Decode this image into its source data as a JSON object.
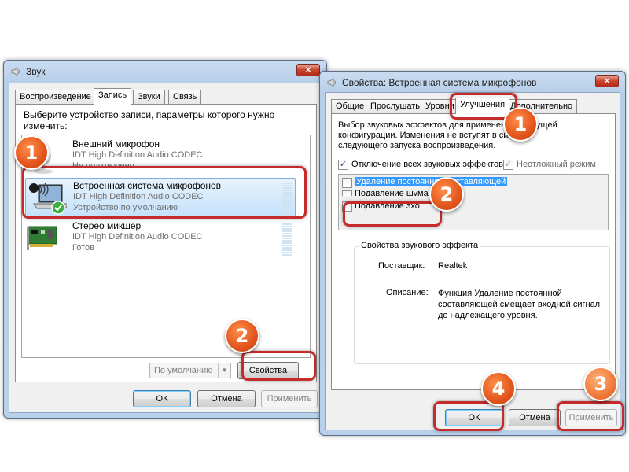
{
  "left_window": {
    "title": "Звук",
    "close_label": "✕",
    "tabs": [
      {
        "label": "Воспроизведение"
      },
      {
        "label": "Запись"
      },
      {
        "label": "Звуки"
      },
      {
        "label": "Связь"
      }
    ],
    "instruction": "Выберите устройство записи, параметры которого нужно изменить:",
    "devices": [
      {
        "name": "Внешний микрофон",
        "driver": "IDT High Definition Audio CODEC",
        "status": "Не подключено"
      },
      {
        "name": "Встроенная система микрофонов",
        "driver": "IDT High Definition Audio CODEC",
        "status": "Устройство по умолчанию"
      },
      {
        "name": "Стерео микшер",
        "driver": "IDT High Definition Audio CODEC",
        "status": "Готов"
      }
    ],
    "default_select": "По умолчанию",
    "properties_button": "Свойства",
    "ok": "ОК",
    "cancel": "Отмена",
    "apply": "Применить"
  },
  "right_window": {
    "title": "Свойства: Встроенная система микрофонов",
    "close_label": "✕",
    "tabs": [
      {
        "label": "Общие"
      },
      {
        "label": "Прослушать"
      },
      {
        "label": "Уровни"
      },
      {
        "label": "Улучшения"
      },
      {
        "label": "Дополнительно"
      }
    ],
    "description": "Выбор звуковых эффектов для применения к текущей конфигурации. Изменения не вступят в силу до следующего запуска воспроизведения.",
    "disable_all": "Отключение всех звуковых эффектов",
    "immediate_mode": "Неотложный режим",
    "effects": [
      {
        "label": "Удаление постоянной составляющей"
      },
      {
        "label": "Подавление шума"
      },
      {
        "label": "Подавление эхо"
      }
    ],
    "effect_props_title": "Свойства звукового эффекта",
    "vendor_label": "Поставщик:",
    "vendor_value": "Realtek",
    "desc_label": "Описание:",
    "desc_value": "Функция Удаление постоянной составляющей смещает входной сигнал до надлежащего уровня.",
    "ok": "ОК",
    "cancel": "Отмена",
    "apply": "Применить"
  },
  "badges": {
    "left_1": "1",
    "left_2": "2",
    "right_1": "1",
    "right_2": "2",
    "right_3": "3",
    "right_4": "4"
  },
  "colors": {
    "highlight_ring": "#c62b2b",
    "badge": "#e2551c",
    "selection": "#3399ff"
  }
}
